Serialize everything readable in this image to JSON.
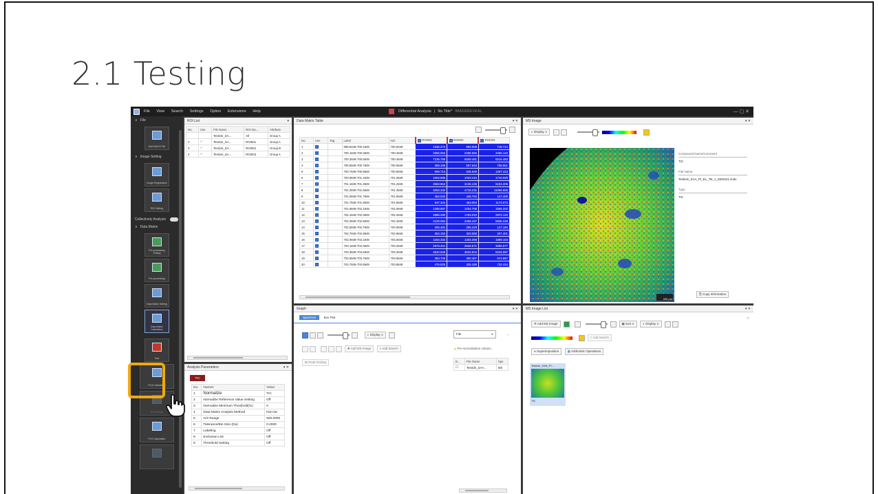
{
  "slide": {
    "title": "2.1 Testing"
  },
  "window": {
    "menu": [
      "File",
      "View",
      "Search",
      "Settings",
      "Option",
      "Extensions",
      "Help"
    ],
    "center_title": "Differential Analysis",
    "doc_title": "No Title*",
    "doc_sub": "IMAGEREVEAL",
    "win_controls": "— ▢ ✕"
  },
  "sidebar": {
    "sections": {
      "file": "File",
      "image_setting": "Image Setting",
      "data_matrix": "Data Matrix",
      "collectively": "Collectively Analysis"
    },
    "tiles": {
      "add_maldi": "Add MALDI File",
      "image_registration": "Image Registration",
      "roi_setting": "ROI Setting",
      "preprocessing_setting": "Pre-processing Setting",
      "preprocessing": "Pre-processing",
      "data_matrix_setting": "Data Matrix Setting",
      "data_matrix_calculation": "Data Matrix Calculation",
      "test": "Test",
      "pca_calculation": "PCA Calculation",
      "pca_result": "PCA Result",
      "pls_calculation": "PLS Calculation"
    }
  },
  "roi_list": {
    "tab": "ROI List",
    "headers": [
      "No.",
      "Use",
      "File Name",
      "ROI Na...",
      "Attribute"
    ],
    "rows": [
      [
        "",
        "",
        "Testicle_SA...",
        "All",
        "Group A"
      ],
      [
        "2",
        "✓",
        "Testicle_SA...",
        "ROI001",
        "Group A"
      ],
      [
        "3",
        "✓",
        "Testicle_SA...",
        "ROI002",
        "Group B"
      ],
      [
        "4",
        "✓",
        "Testicle_SA...",
        "ROI003",
        "Group A"
      ]
    ]
  },
  "analysis_params": {
    "title": "Analysis Parameters",
    "tab": "TIC",
    "headers": [
      "No.",
      "Names",
      "Value"
    ],
    "rows": [
      [
        "1",
        "Normalize",
        "TIC"
      ],
      [
        "2",
        "Normalize Reference Value Setting",
        "Off"
      ],
      [
        "3",
        "Normalize Minimum Threshold(%)",
        "0"
      ],
      [
        "4",
        "Data Matrix Analysis Method",
        "Non-tar"
      ],
      [
        "5",
        "m/z Range",
        "600.0000"
      ],
      [
        "6",
        "Tolerance/Bin Size (Da)",
        "0.2000"
      ],
      [
        "7",
        "Labeling",
        "Off"
      ],
      [
        "8",
        "Exclusion List",
        "Off"
      ],
      [
        "9",
        "Threshold Setting",
        "Off"
      ]
    ]
  },
  "data_matrix": {
    "title": "Data Matrix Table",
    "headers": [
      "No.",
      "Use",
      "Tag",
      "Label",
      "m/z",
      "ROI001",
      "ROI002",
      "ROI003"
    ],
    "rows": [
      [
        "1",
        "699.8449-700.1849",
        "700.0049",
        "1335.272",
        "993.008",
        "719.714"
      ],
      [
        "2",
        "700.1849-700.3849",
        "700.2849",
        "3255.053",
        "2285.656",
        "4256.143"
      ],
      [
        "3",
        "700.3849-700.5849",
        "700.4849",
        "7135.789",
        "6658.481",
        "8215.483"
      ],
      [
        "4",
        "700.5849-700.7849",
        "700.6849",
        "358.186",
        "557.643",
        "706.661"
      ],
      [
        "5",
        "700.7849-700.9849",
        "700.8849",
        "599.713",
        "535.929",
        "1297.413"
      ],
      [
        "6",
        "700.9849-701.1849",
        "701.0849",
        "1603.896",
        "1003.415",
        "1710.029"
      ],
      [
        "7",
        "701.1849-701.3849",
        "701.2849",
        "2563.864",
        "2135.136",
        "6153.206"
      ],
      [
        "8",
        "701.3849-701.5849",
        "701.4849",
        "4053.340",
        "4716.231",
        "11056.905"
      ],
      [
        "9",
        "701.5849-701.7849",
        "701.6849",
        "354.020",
        "445.763",
        "147.400"
      ],
      [
        "10",
        "701.7849-701.9849",
        "701.8849",
        "547.404",
        "453.094",
        "1173.073"
      ],
      [
        "11",
        "701.9849-702.1849",
        "702.0849",
        "1298.887",
        "1004.758",
        "1599.202"
      ],
      [
        "12",
        "702.1849-702.3849",
        "702.2849",
        "2986.290",
        "1753.010",
        "2972.140"
      ],
      [
        "13",
        "702.3849-702.5849",
        "702.4849",
        "2129.094",
        "2368.437",
        "5835.236"
      ],
      [
        "14",
        "702.5849-702.7849",
        "702.6849",
        "205.491",
        "295.229",
        "127.194"
      ],
      [
        "15",
        "702.7849-702.9849",
        "702.8849",
        "254.150",
        "323.080",
        "207.401"
      ],
      [
        "16",
        "702.9849-703.1849",
        "703.0849",
        "1163.332",
        "1304.398",
        "1899.103"
      ],
      [
        "17",
        "703.1849-703.3849",
        "703.2849",
        "2979.401",
        "2536.871",
        "3085.877"
      ],
      [
        "18",
        "703.3849-703.5849",
        "703.4849",
        "4640.529",
        "3625.504",
        "6233.597"
      ],
      [
        "19",
        "703.5849-703.7849",
        "703.6849",
        "383.706",
        "390.487",
        "674.867"
      ],
      [
        "20",
        "703.7849-703.9849",
        "703.8849",
        "476.825",
        "335.189",
        "732.434"
      ]
    ]
  },
  "ms_image": {
    "title": "MS Image",
    "display_btn": "Display",
    "info_labels": [
      "Compound Name/Comment",
      "File Name",
      "Type"
    ],
    "info_values": [
      "TIC",
      "Testicle_SAA_PI_EL_Tst_1_MS0421.imdx",
      "TIC"
    ],
    "copy_btn": "Copy Information",
    "scale_label": "200 μm"
  },
  "graph": {
    "title": "Graph",
    "tabs": [
      "Spectrum",
      "Box Plot"
    ],
    "display_btn": "Display",
    "add_ms_image": "Add MS Image",
    "add_search": "Add Search",
    "peak_picking": "Peak Picking",
    "file_select": "File",
    "warning": "Pre-normalization calcula...",
    "file_headers": [
      "D...",
      "File Name",
      "Spe"
    ],
    "file_row": "Testicle_SAA..."
  },
  "ms_image_list": {
    "title": "MS Image List",
    "add_btn": "Add MS Image",
    "sort_btn": "Sort",
    "display_btn": "Display",
    "add_search": "Add Search",
    "superimposition": "Superimposition",
    "arithmetic": "Arithmetic Operations",
    "thumb_name": "Testicle_SAA_PI...",
    "thumb_type": "TIC"
  }
}
